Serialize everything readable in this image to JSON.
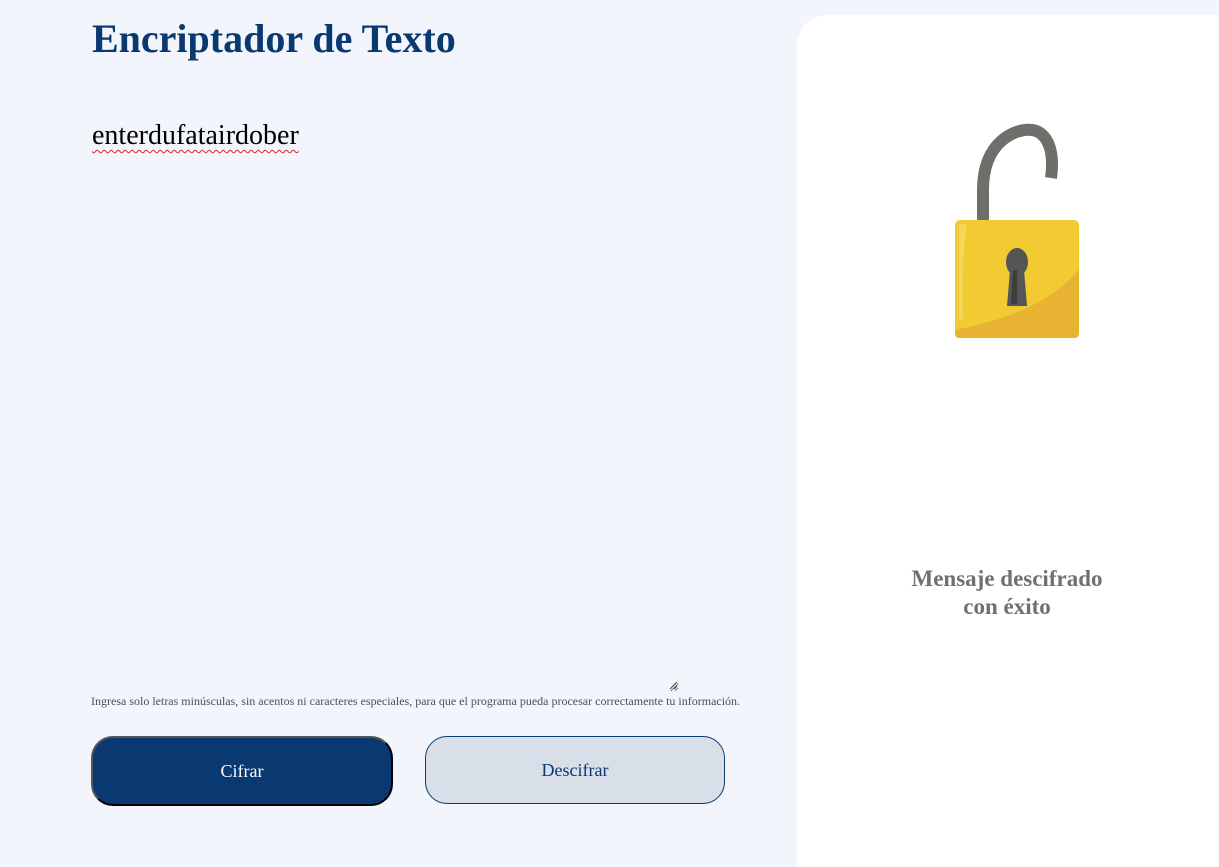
{
  "header": {
    "title": "Encriptador de Texto"
  },
  "input": {
    "value": "enterdufatairdober"
  },
  "hint": {
    "text": "Ingresa solo letras minúsculas, sin acentos ni caracteres especiales, para que el programa pueda procesar correctamente tu información."
  },
  "buttons": {
    "encrypt_label": "Cifrar",
    "decrypt_label": "Descifrar"
  },
  "result_panel": {
    "line1": "Mensaje descifrado",
    "line2": "con éxito",
    "image_icon": "unlocked-padlock-icon"
  },
  "colors": {
    "brand": "#0a3871",
    "background": "#f3f5fc",
    "panel": "#ffffff",
    "result_text": "#6f716f",
    "padlock_body": "#f2cb32",
    "padlock_shackle": "#6e6e6a"
  }
}
